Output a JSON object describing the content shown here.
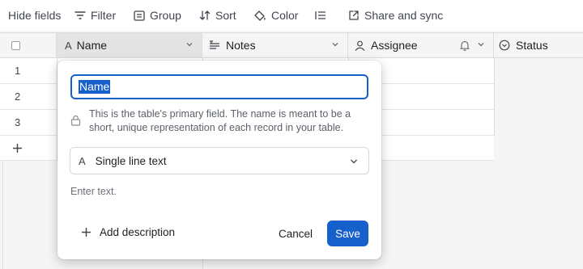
{
  "toolbar": {
    "hide_fields": "Hide fields",
    "filter": "Filter",
    "group": "Group",
    "sort": "Sort",
    "color": "Color",
    "share_sync": "Share and sync"
  },
  "columns": [
    {
      "label": "Name",
      "icon": "text-a-icon"
    },
    {
      "label": "Notes",
      "icon": "long-text-icon"
    },
    {
      "label": "Assignee",
      "icon": "user-icon"
    },
    {
      "label": "Status",
      "icon": "status-circle-icon"
    }
  ],
  "rows": [
    "1",
    "2",
    "3"
  ],
  "popup": {
    "field_name_value": "Name",
    "info_text": "This is the table's primary field. The name is meant to be a short, unique representation of each record in your table.",
    "field_type": "Single line text",
    "default_placeholder": "Enter text.",
    "add_description": "Add description",
    "cancel": "Cancel",
    "save": "Save"
  },
  "colors": {
    "accent": "#1660cc",
    "header_bg": "#f5f5f5",
    "border": "#dcdcdc"
  }
}
